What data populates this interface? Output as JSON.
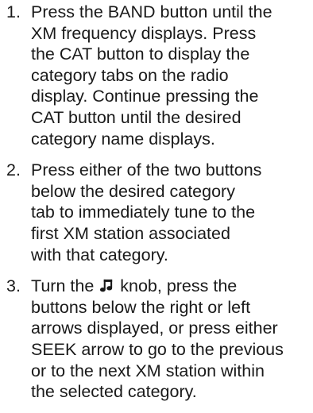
{
  "steps": [
    {
      "number": "1.",
      "lines": [
        "Press the BAND button until the",
        "XM frequency displays. Press",
        "the CAT button to display the",
        "category tabs on the radio",
        "display. Continue pressing the",
        "CAT button until the desired",
        "category name displays."
      ]
    },
    {
      "number": "2.",
      "lines": [
        "Press either of the two buttons",
        "below the desired category",
        "tab to immediately tune to the",
        "first XM station associated",
        "with that category."
      ]
    },
    {
      "number": "3.",
      "line1_before_icon": "Turn the",
      "line1_after_icon": "knob, press the",
      "icon": "music-note-icon",
      "lines": [
        "buttons below the right or left",
        "arrows displayed, or press either",
        "SEEK arrow to go to the previous",
        "or to the next XM station within",
        "the selected category."
      ]
    }
  ]
}
